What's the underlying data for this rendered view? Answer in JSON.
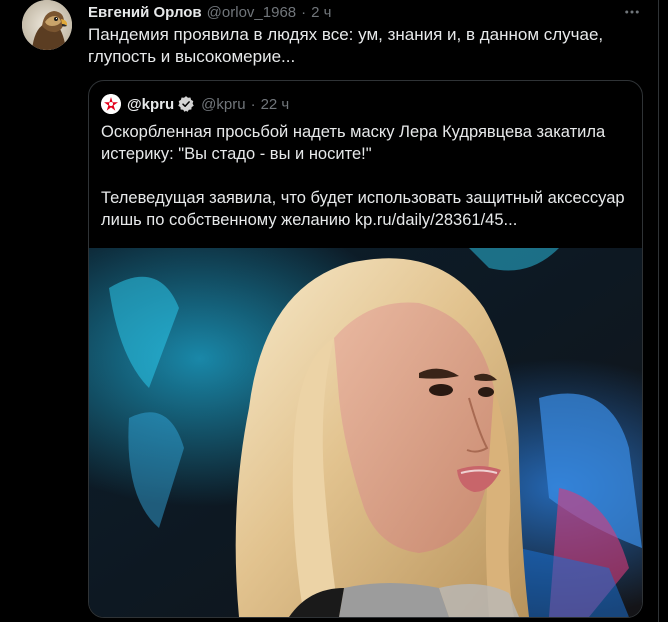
{
  "tweet": {
    "author_name": "Евгений Орлов",
    "author_handle": "@orlov_1968",
    "separator": "·",
    "time": "2 ч",
    "text": "Пандемия проявила в людях все: ум, знания и, в данном случае, глупость и высокомерие...",
    "avatar_icon": "eagle-avatar",
    "more_icon": "more-horizontal-icon"
  },
  "quote": {
    "name": "@kpru",
    "handle": "@kpru",
    "separator": "·",
    "time": "22 ч",
    "paragraph1": "Оскорбленная просьбой надеть маску Лера Кудрявцева закатила истерику: \"Вы стадо - вы и носите!\"",
    "paragraph2": "Телеведущая заявила, что будет использовать защитный аксессуар лишь по собственному желанию kp.ru/daily/28361/45...",
    "avatar_icon": "kp-logo",
    "verified_icon": "verified-badge-icon"
  },
  "colors": {
    "background": "#000000",
    "primary_text": "#e7e9ea",
    "secondary_text": "#71767b",
    "border": "#2f3336",
    "kp_red": "#e3001b"
  }
}
